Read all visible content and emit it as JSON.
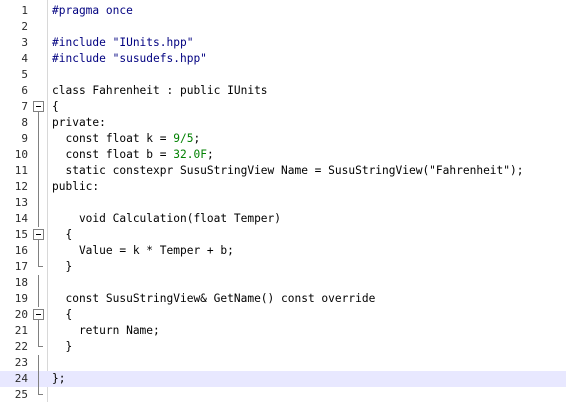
{
  "editor": {
    "current_line": 24,
    "colors": {
      "preprocessor": "#000080",
      "number": "#008000",
      "text": "#000000",
      "line_numbers": "#2b2b2b",
      "current_line_bg": "#e8e8ff"
    },
    "lines": [
      {
        "n": "1",
        "fold": "none",
        "segs": [
          {
            "t": "#pragma once",
            "c": "pp"
          }
        ]
      },
      {
        "n": "2",
        "fold": "none",
        "segs": []
      },
      {
        "n": "3",
        "fold": "none",
        "segs": [
          {
            "t": "#include \"IUnits.hpp\"",
            "c": "pp"
          }
        ]
      },
      {
        "n": "4",
        "fold": "none",
        "segs": [
          {
            "t": "#include \"susudefs.hpp\"",
            "c": "pp"
          }
        ]
      },
      {
        "n": "5",
        "fold": "none",
        "segs": []
      },
      {
        "n": "6",
        "fold": "none",
        "segs": [
          {
            "t": "class Fahrenheit : public IUnits",
            "c": "kw"
          }
        ]
      },
      {
        "n": "7",
        "fold": "open",
        "segs": [
          {
            "t": "{",
            "c": "kw"
          }
        ]
      },
      {
        "n": "8",
        "fold": "line",
        "segs": [
          {
            "t": "private:",
            "c": "kw"
          }
        ]
      },
      {
        "n": "9",
        "fold": "line",
        "segs": [
          {
            "t": "  const float k = ",
            "c": "kw"
          },
          {
            "t": "9/5",
            "c": "num"
          },
          {
            "t": ";",
            "c": "kw"
          }
        ]
      },
      {
        "n": "10",
        "fold": "line",
        "segs": [
          {
            "t": "  const float b = ",
            "c": "kw"
          },
          {
            "t": "32.0F",
            "c": "num"
          },
          {
            "t": ";",
            "c": "kw"
          }
        ]
      },
      {
        "n": "11",
        "fold": "line",
        "segs": [
          {
            "t": "  static constexpr SusuStringView Name = SusuStringView(\"Fahrenheit\");",
            "c": "kw"
          }
        ]
      },
      {
        "n": "12",
        "fold": "line",
        "segs": [
          {
            "t": "public:",
            "c": "kw"
          }
        ]
      },
      {
        "n": "13",
        "fold": "line",
        "segs": []
      },
      {
        "n": "14",
        "fold": "line",
        "segs": [
          {
            "t": "    void Calculation(float Temper)",
            "c": "kw"
          }
        ]
      },
      {
        "n": "15",
        "fold": "open",
        "segs": [
          {
            "t": "  {",
            "c": "kw"
          }
        ]
      },
      {
        "n": "16",
        "fold": "line",
        "segs": [
          {
            "t": "    Value = k * Temper + b;",
            "c": "kw"
          }
        ]
      },
      {
        "n": "17",
        "fold": "end",
        "segs": [
          {
            "t": "  }",
            "c": "kw"
          }
        ]
      },
      {
        "n": "18",
        "fold": "line",
        "segs": []
      },
      {
        "n": "19",
        "fold": "line",
        "segs": [
          {
            "t": "  const SusuStringView& GetName() const override",
            "c": "kw"
          }
        ]
      },
      {
        "n": "20",
        "fold": "open",
        "segs": [
          {
            "t": "  {",
            "c": "kw"
          }
        ]
      },
      {
        "n": "21",
        "fold": "line",
        "segs": [
          {
            "t": "    return Name;",
            "c": "kw"
          }
        ]
      },
      {
        "n": "22",
        "fold": "end",
        "segs": [
          {
            "t": "  }",
            "c": "kw"
          }
        ]
      },
      {
        "n": "23",
        "fold": "line",
        "segs": []
      },
      {
        "n": "24",
        "fold": "line",
        "segs": [
          {
            "t": "};",
            "c": "kw"
          }
        ]
      },
      {
        "n": "25",
        "fold": "end",
        "segs": []
      }
    ]
  }
}
